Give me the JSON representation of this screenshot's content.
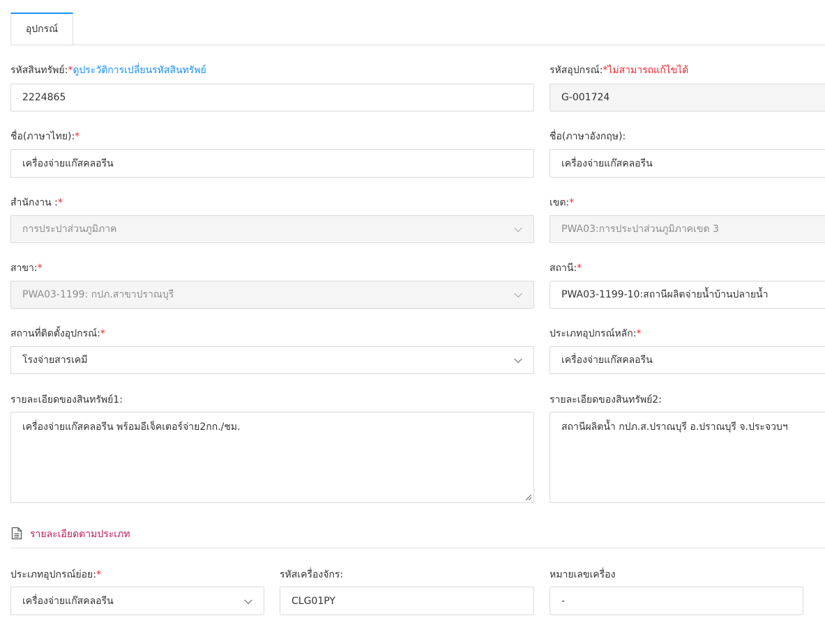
{
  "tabs": [
    {
      "label": "อุปกรณ์"
    }
  ],
  "required_mark": "*",
  "asset_code": {
    "label": "รหัสสินทรัพย์:",
    "history_link": "ดูประวัติการเปลี่ยนรหัสสินทรัพย์",
    "value": "2224865"
  },
  "equipment_code": {
    "label": "รหัสอุปกรณ์:",
    "note": "ไม่สามารถแก้ไขได้",
    "value": "G-001724"
  },
  "name_th": {
    "label": "ชื่อ(ภาษาไทย):",
    "value": "เครื่องจ่ายแก๊สคลอรีน"
  },
  "name_en": {
    "label": "ชื่อ(ภาษาอังกฤษ):",
    "value": "เครื่องจ่ายแก๊สคลอรีน"
  },
  "office": {
    "label": "สำนักงาน :",
    "value": "การประปาส่วนภูมิภาค"
  },
  "zone": {
    "label": "เขต:",
    "value": "PWA03:การประปาส่วนภูมิภาคเขต 3"
  },
  "branch": {
    "label": "สาขา:",
    "value": "PWA03-1199: กปภ.สาขาปราณบุรี"
  },
  "station": {
    "label": "สถานี:",
    "value": "PWA03-1199-10:สถานีผลิตจ่ายน้ำบ้านปลายน้ำ"
  },
  "install_location": {
    "label": "สถานที่ติดตั้งอุปกรณ์:",
    "value": "โรงจ่ายสารเคมี"
  },
  "main_type": {
    "label": "ประเภทอุปกรณ์หลัก:",
    "value": "เครื่องจ่ายแก๊สคลอรีน"
  },
  "asset_detail1": {
    "label": "รายละเอียดของสินทรัพย์1:",
    "value": "เครื่องจ่ายแก๊สคลอรีน พร้อมอีเจ็คเตอร์จ่าย2กก./ชม."
  },
  "asset_detail2": {
    "label": "รายละเอียดของสินทรัพย์2:",
    "value": "สถานีผลิตน้ำ กปภ.ส.ปราณบุรี อ.ปราณบุรี จ.ประจวบฯ"
  },
  "type_section": {
    "title": "รายละเอียดตามประเภท"
  },
  "sub_type": {
    "label": "ประเภทอุปกรณ์ย่อย:",
    "value": "เครื่องจ่ายแก๊สคลอรีน"
  },
  "machine_code": {
    "label": "รหัสเครื่องจักร:",
    "value": "CLG01PY"
  },
  "machine_number": {
    "label": "หมายเลขเครื่อง",
    "value": "-"
  }
}
